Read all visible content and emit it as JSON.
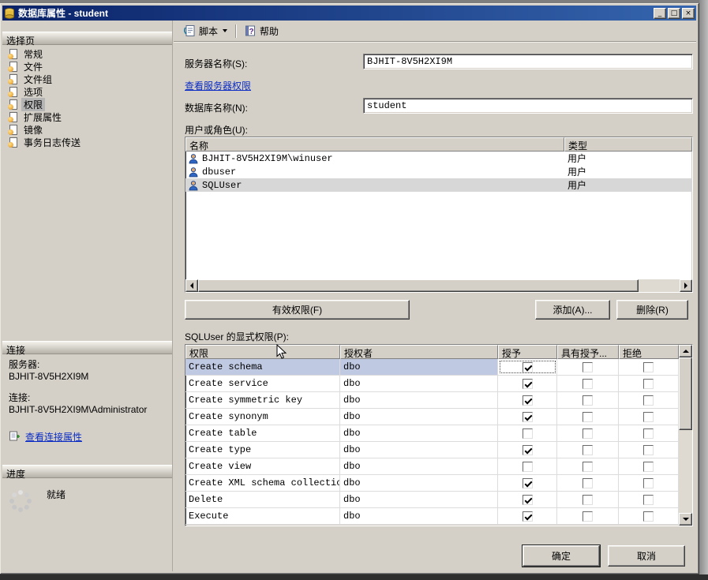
{
  "window": {
    "title": "数据库属性 - student",
    "minimize_glyph": "_",
    "maximize_glyph": "□",
    "close_glyph": "×"
  },
  "toolbar": {
    "script_label": "脚本",
    "help_label": "帮助"
  },
  "sidebar": {
    "select_page_header": "选择页",
    "pages": [
      {
        "key": "general",
        "label": "常规",
        "selected": false
      },
      {
        "key": "files",
        "label": "文件",
        "selected": false
      },
      {
        "key": "filegroups",
        "label": "文件组",
        "selected": false
      },
      {
        "key": "options",
        "label": "选项",
        "selected": false
      },
      {
        "key": "permissions",
        "label": "权限",
        "selected": true
      },
      {
        "key": "extended-properties",
        "label": "扩展属性",
        "selected": false
      },
      {
        "key": "mirroring",
        "label": "镜像",
        "selected": false
      },
      {
        "key": "transaction-log-shipping",
        "label": "事务日志传送",
        "selected": false
      }
    ],
    "connection_header": "连接",
    "server_label": "服务器:",
    "server_value": "BJHIT-8V5H2XI9M",
    "connection_label": "连接:",
    "connection_value": "BJHIT-8V5H2XI9M\\Administrator",
    "view_connection_link": "查看连接属性",
    "progress_header": "进度",
    "progress_status": "就绪"
  },
  "main": {
    "server_name_label": "服务器名称(S):",
    "server_name_value": "BJHIT-8V5H2XI9M",
    "view_server_permissions_link": "查看服务器权限",
    "database_name_label": "数据库名称(N):",
    "database_name_value": "student",
    "users_label": "用户或角色(U):",
    "users_table": {
      "columns": [
        "名称",
        "类型"
      ],
      "rows": [
        {
          "name": "BJHIT-8V5H2XI9M\\winuser",
          "type": "用户",
          "selected": false
        },
        {
          "name": "dbuser",
          "type": "用户",
          "selected": false
        },
        {
          "name": "SQLUser",
          "type": "用户",
          "selected": true
        }
      ]
    },
    "effective_permissions_button": "有效权限(F)",
    "add_button": "添加(A)...",
    "remove_button": "删除(R)",
    "explicit_permissions_label": "SQLUser 的显式权限(P):",
    "permissions_table": {
      "columns": [
        "权限",
        "授权者",
        "授予",
        "具有授予...",
        "拒绝"
      ],
      "rows": [
        {
          "permission": "Create schema",
          "grantor": "dbo",
          "grant": true,
          "with_grant": false,
          "deny": false,
          "selected": true
        },
        {
          "permission": "Create service",
          "grantor": "dbo",
          "grant": true,
          "with_grant": false,
          "deny": false,
          "selected": false
        },
        {
          "permission": "Create symmetric key",
          "grantor": "dbo",
          "grant": true,
          "with_grant": false,
          "deny": false,
          "selected": false
        },
        {
          "permission": "Create synonym",
          "grantor": "dbo",
          "grant": true,
          "with_grant": false,
          "deny": false,
          "selected": false
        },
        {
          "permission": "Create table",
          "grantor": "dbo",
          "grant": false,
          "with_grant": false,
          "deny": false,
          "selected": false
        },
        {
          "permission": "Create type",
          "grantor": "dbo",
          "grant": true,
          "with_grant": false,
          "deny": false,
          "selected": false
        },
        {
          "permission": "Create view",
          "grantor": "dbo",
          "grant": false,
          "with_grant": false,
          "deny": false,
          "selected": false
        },
        {
          "permission": "Create XML schema collection",
          "grantor": "dbo",
          "grant": true,
          "with_grant": false,
          "deny": false,
          "selected": false
        },
        {
          "permission": "Delete",
          "grantor": "dbo",
          "grant": true,
          "with_grant": false,
          "deny": false,
          "selected": false
        },
        {
          "permission": "Execute",
          "grantor": "dbo",
          "grant": true,
          "with_grant": false,
          "deny": false,
          "selected": false
        }
      ]
    },
    "ok_button": "确定",
    "cancel_button": "取消"
  }
}
